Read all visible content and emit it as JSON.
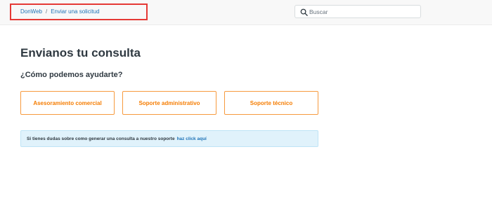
{
  "breadcrumb": {
    "home": "DonWeb",
    "separator": "/",
    "current": "Enviar una solicitud"
  },
  "search": {
    "placeholder": "Buscar",
    "icon": "search-icon"
  },
  "page": {
    "title": "Envianos tu consulta",
    "subtitle": "¿Cómo podemos ayudarte?"
  },
  "options": [
    {
      "label": "Asesoramiento comercial"
    },
    {
      "label": "Soporte administrativo"
    },
    {
      "label": "Soporte técnico"
    }
  ],
  "info": {
    "text": "Si tienes dudas sobre como generar una consulta a nuestro soporte",
    "link": "haz click aquí"
  },
  "colors": {
    "accent": "#f57c00",
    "link": "#1f73b7",
    "highlight_border": "#e53935",
    "info_background": "#e0f2fb"
  }
}
